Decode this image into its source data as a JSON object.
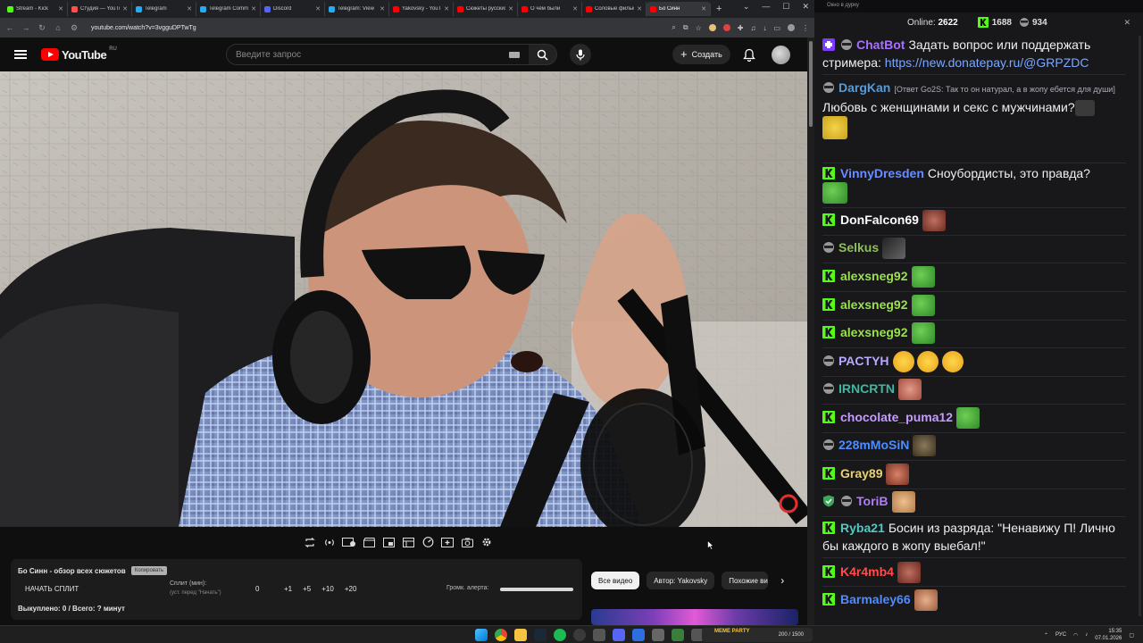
{
  "browser": {
    "tabs": [
      {
        "title": "Stream - Kick",
        "color": "#53fc18"
      },
      {
        "title": "Студия — YouTube",
        "color": "#ff4f4f"
      },
      {
        "title": "Telegram",
        "color": "#2aabee"
      },
      {
        "title": "Telegram Comments",
        "color": "#2aabee"
      },
      {
        "title": "Discord",
        "color": "#5865f2"
      },
      {
        "title": "Telegram: View",
        "color": "#2aabee"
      },
      {
        "title": "Yakovsky - YouTube",
        "color": "#ff0000"
      },
      {
        "title": "Сюжеты русских",
        "color": "#ff0000"
      },
      {
        "title": "О чём были",
        "color": "#ff0000"
      },
      {
        "title": "Соловые фильмы",
        "color": "#ff0000"
      },
      {
        "title": "Бо Синн",
        "color": "#ff0000"
      }
    ],
    "url": "youtube.com/watch?v=3vgguDPTwTg"
  },
  "youtube": {
    "logo_text": "YouTube",
    "region": "RU",
    "search_placeholder": "Введите запрос",
    "create_label": "Создать"
  },
  "panel": {
    "title": "Бо Синн - обзор всех сюжетов",
    "copy_label": "Копировать",
    "start_split": "НАЧАТЬ СПЛИТ",
    "split_label": "Сплит (мин):",
    "split_hint": "(уст. перед \"Начать\")",
    "split_value": "0",
    "split_buttons": [
      "+1",
      "+5",
      "+10",
      "+20"
    ],
    "alert_label": "Громк. алерта:",
    "alert_volume": 1.0,
    "bought": "Выкуплено: 0 / Всего: ? минут"
  },
  "chips": [
    "Все видео",
    "Автор: Yakovsky",
    "Похожие видео"
  ],
  "chat": {
    "window_title": "Окно в дурку",
    "online_label": "Online:",
    "online_count": "2622",
    "kick_count": "1688",
    "other_count": "934",
    "messages": [
      {
        "user": "ChatBot",
        "color": "#a970ff",
        "text": "Задать вопрос или поддержать стримера: ",
        "link": "https://new.donatepay.ru/@GRPZDC"
      },
      {
        "user": "DargKan",
        "color": "#5a9bd5",
        "reply": "[Ответ Go2S: Так то он натурал, а в жопу ебется для души]",
        "text": "Любовь с женщинами и секс с мужчинами?"
      },
      {
        "user": "VinnyDresden",
        "color": "#6b8cff",
        "text": "Сноубордисты, это правда?"
      },
      {
        "user": "DonFalcon69",
        "color": "#ffffff",
        "text": ""
      },
      {
        "user": "Selkus",
        "color": "#8fbf5a",
        "text": ""
      },
      {
        "user": "alexsneg92",
        "color": "#9be04f",
        "text": ""
      },
      {
        "user": "alexsneg92",
        "color": "#9be04f",
        "text": ""
      },
      {
        "user": "alexsneg92",
        "color": "#9be04f",
        "text": ""
      },
      {
        "user": "PACTYH",
        "color": "#b9a8ff",
        "text": ""
      },
      {
        "user": "IRNCRTN",
        "color": "#3fb8a0",
        "text": ""
      },
      {
        "user": "chocolate_puma12",
        "color": "#c59bff",
        "text": ""
      },
      {
        "user": "228mMoSiN",
        "color": "#4e8cff",
        "text": ""
      },
      {
        "user": "Gray89",
        "color": "#e8d27a",
        "text": ""
      },
      {
        "user": "ToriB",
        "color": "#b07cff",
        "text": ""
      },
      {
        "user": "Ryba21",
        "color": "#53c8c0",
        "text": "Босин из разряда: \"Ненавижу П! Лично бы каждого в жопу выебал!\""
      },
      {
        "user": "K4r4mb4",
        "color": "#ff4d4d",
        "text": ""
      },
      {
        "user": "Barmaley66",
        "color": "#4e8cff",
        "text": ""
      }
    ]
  },
  "taskbar": {
    "widget_label": "MEME PARTY",
    "widget_value": "200 / 1500",
    "lang": "РУС",
    "time": "15:35",
    "date": "07.01.2026"
  }
}
